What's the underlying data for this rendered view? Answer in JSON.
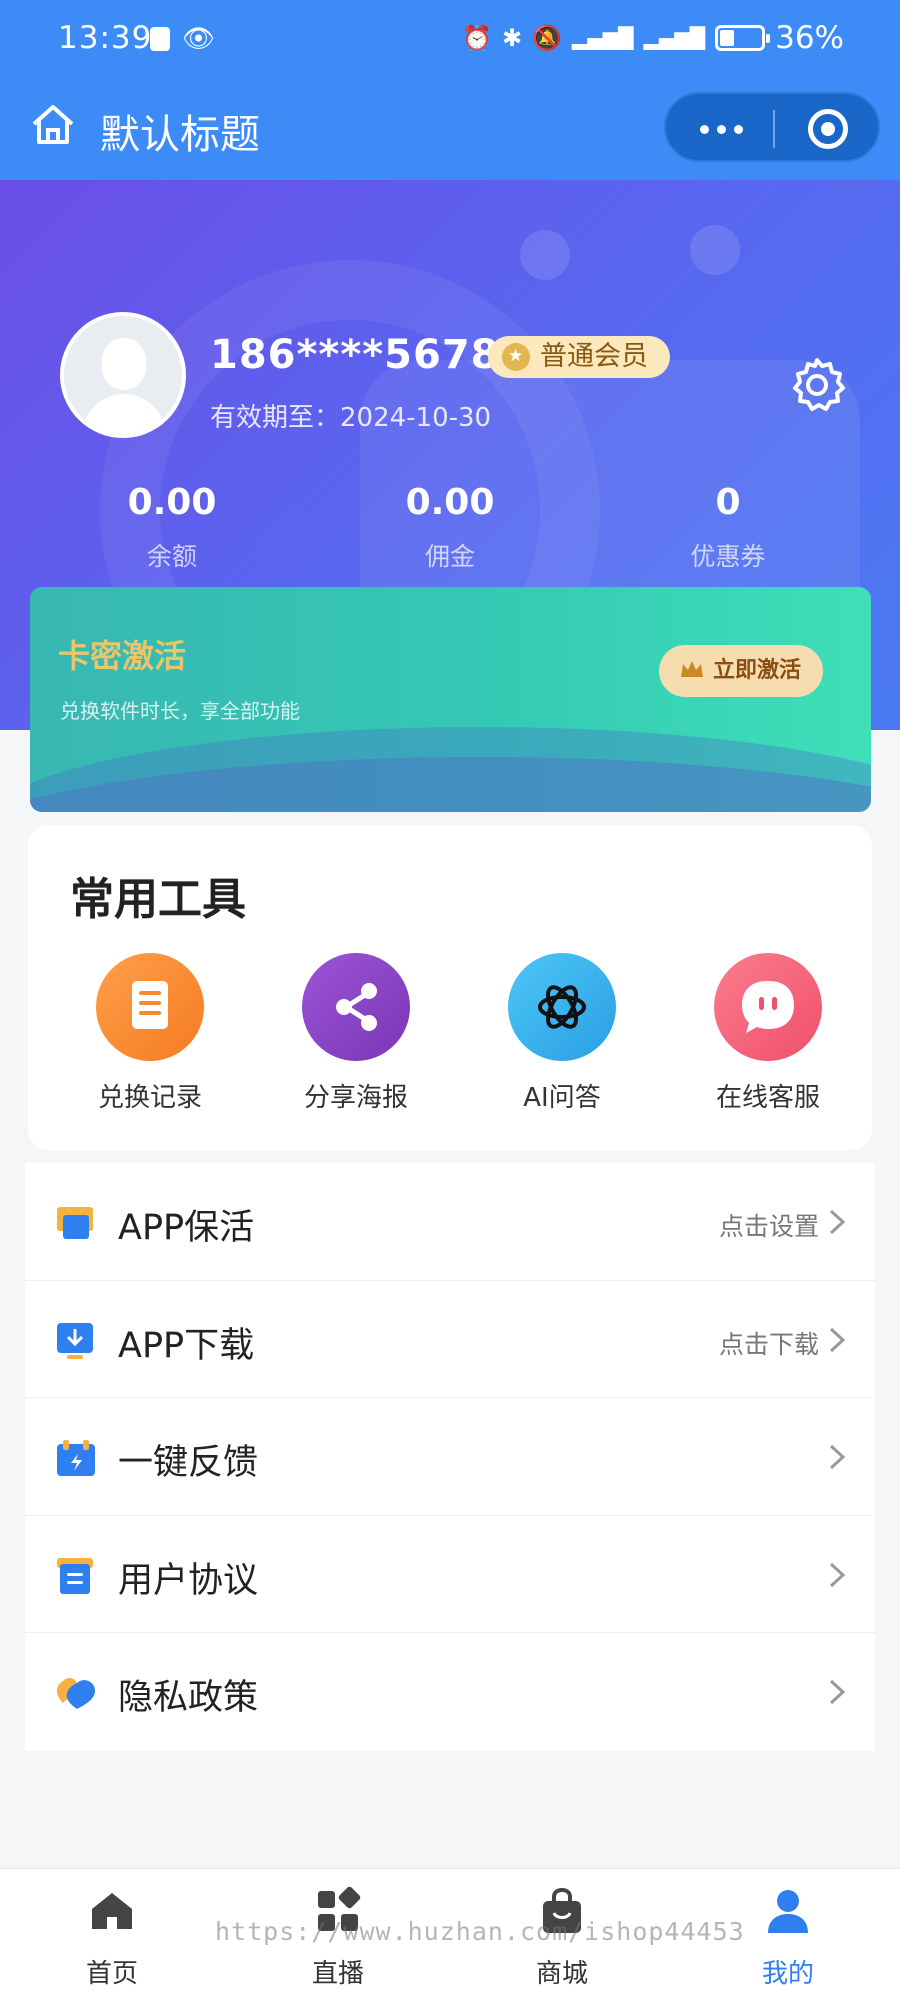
{
  "status_bar": {
    "time": "13:39",
    "battery": "36%",
    "battery_level": 0.36
  },
  "nav": {
    "title": "默认标题"
  },
  "profile": {
    "phone": "186****5678",
    "member_badge": "普通会员",
    "expire_text": "有效期至：2024-10-30"
  },
  "stats": [
    {
      "value": "0.00",
      "label": "余额"
    },
    {
      "value": "0.00",
      "label": "佣金"
    },
    {
      "value": "0",
      "label": "优惠券"
    }
  ],
  "activation": {
    "title": "卡密激活",
    "subtitle": "兑换软件时长，享全部功能",
    "button": "立即激活"
  },
  "tools": {
    "heading": "常用工具",
    "items": [
      {
        "label": "兑换记录",
        "icon": "document-icon",
        "color": "#f68a2d"
      },
      {
        "label": "分享海报",
        "icon": "share-icon",
        "color": "#8a45c6"
      },
      {
        "label": "AI问答",
        "icon": "ai-knot-icon",
        "color": "#3bb4ee"
      },
      {
        "label": "在线客服",
        "icon": "chat-bubble-icon",
        "color": "#f2617a"
      }
    ]
  },
  "menu": [
    {
      "label": "APP保活",
      "hint": "点击设置"
    },
    {
      "label": "APP下载",
      "hint": "点击下载"
    },
    {
      "label": "一键反馈",
      "hint": ""
    },
    {
      "label": "用户协议",
      "hint": ""
    },
    {
      "label": "隐私政策",
      "hint": ""
    }
  ],
  "tabbar": [
    {
      "label": "首页",
      "icon": "home-icon"
    },
    {
      "label": "直播",
      "icon": "grid-icon"
    },
    {
      "label": "商城",
      "icon": "bag-icon"
    },
    {
      "label": "我的",
      "icon": "user-icon",
      "active": true
    }
  ],
  "watermark": "https://www.huzhan.com/ishop44453",
  "colors": {
    "primary": "#3d8bf7",
    "active_tab": "#2f7ff0"
  }
}
